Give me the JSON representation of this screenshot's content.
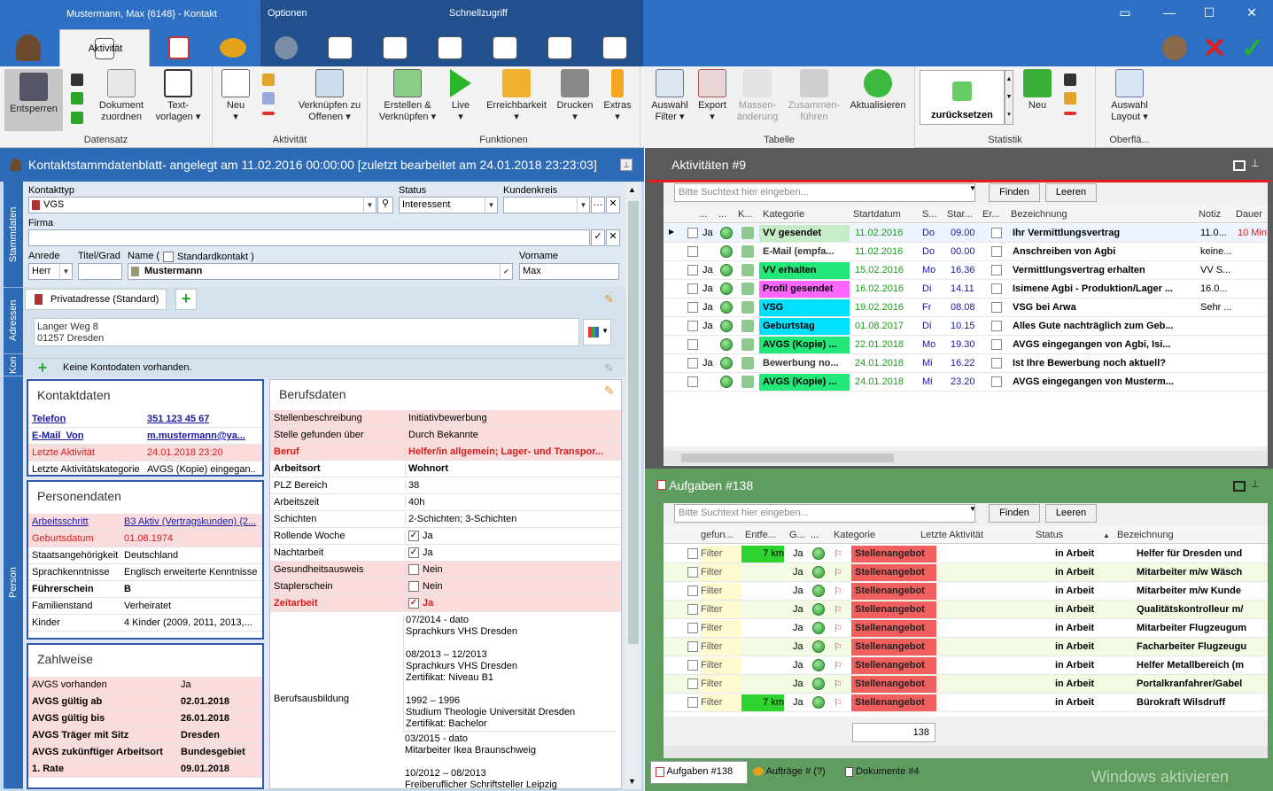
{
  "window": {
    "title": "Mustermann, Max {6148} - Kontakt",
    "ctx_optionen": "Optionen",
    "ctx_schnell": "Schnellzugriff"
  },
  "tabs": {
    "aktivitaet": "Aktivität"
  },
  "ribbon": {
    "datensatz": {
      "name": "Datensatz",
      "entsperren": "Entsperren",
      "dokument": "Dokument zuordnen",
      "textvorlagen": "Text- vorlagen"
    },
    "aktivitaet": {
      "name": "Aktivität",
      "neu": "Neu",
      "verknuepfen": "Verknüpfen zu Offenen"
    },
    "funktionen": {
      "name": "Funktionen",
      "erstellen": "Erstellen & Verknüpfen",
      "live": "Live",
      "erreichbarkeit": "Erreichbarkeit",
      "drucken": "Drucken",
      "extras": "Extras"
    },
    "tabelle": {
      "name": "Tabelle",
      "auswahl": "Auswahl Filter",
      "export": "Export",
      "masse": "Massen- änderung",
      "zusammen": "Zusammen- führen",
      "aktualisieren": "Aktualisieren"
    },
    "statistik": {
      "name": "Statistik",
      "zurueck": "zurücksetzen",
      "neu": "Neu"
    },
    "oberflaeche": {
      "name": "Oberflä...",
      "layout": "Auswahl Layout"
    }
  },
  "left": {
    "header": "Kontaktstammdatenblatt- angelegt am 11.02.2016 00:00:00 [zuletzt bearbeitet am 24.01.2018 23:23:03]",
    "sidetabs": {
      "stamm": "Stammdaten",
      "adressen": "Adressen",
      "kon": "Kon",
      "person": "Person"
    },
    "fields": {
      "kontakttyp_l": "Kontakttyp",
      "kontakttyp": "VGS",
      "status_l": "Status",
      "status": "Interessent",
      "kundenkreis_l": "Kundenkreis",
      "firma_l": "Firma",
      "anrede_l": "Anrede",
      "anrede": "Herr",
      "titel_l": "Titel/Grad",
      "name_l": "Name (",
      "standard_l": "Standardkontakt )",
      "name": "Mustermann",
      "vorname_l": "Vorname",
      "vorname": "Max"
    },
    "address": {
      "tab": "Privatadresse (Standard)",
      "line1": "Langer Weg 8",
      "line2": "01257 Dresden"
    },
    "konto": "Keine Kontodaten vorhanden.",
    "kontaktdaten": {
      "title": "Kontaktdaten",
      "rows": [
        [
          "Telefon",
          "351 123 45 67"
        ],
        [
          "E-Mail_Von",
          "m.mustermann@ya..."
        ],
        [
          "Letzte Aktivität",
          "24.01.2018 23:20"
        ],
        [
          "Letzte Aktivitätskategorie",
          "AVGS (Kopie) eingegan..."
        ]
      ]
    },
    "personendaten": {
      "title": "Personendaten",
      "rows": [
        [
          "Arbeitsschritt",
          "B3 Aktiv (Vertragskunden) {2..."
        ],
        [
          "Geburtsdatum",
          "01.08.1974"
        ],
        [
          "Staatsangehörigkeit",
          "Deutschland"
        ],
        [
          "Sprachkenntnisse",
          "Englisch erweiterte Kenntnisse"
        ],
        [
          "Führerschein",
          "B"
        ],
        [
          "Familienstand",
          "Verheiratet"
        ],
        [
          "Kinder",
          "4 Kinder (2009, 2011, 2013,..."
        ]
      ]
    },
    "zahlweise": {
      "title": "Zahlweise",
      "rows": [
        [
          "AVGS vorhanden",
          "Ja"
        ],
        [
          "AVGS gültig ab",
          "02.01.2018"
        ],
        [
          "AVGS gültig bis",
          "26.01.2018"
        ],
        [
          "AVGS Träger mit Sitz",
          "Dresden"
        ],
        [
          "AVGS zukünftiger Arbeitsort",
          "Bundesgebiet"
        ],
        [
          "1. Rate",
          "09.01.2018"
        ]
      ]
    },
    "berufsdaten": {
      "title": "Berufsdaten",
      "rows": [
        [
          "Stellenbeschreibung",
          "Initiativbewerbung"
        ],
        [
          "Stelle gefunden über",
          "Durch Bekannte"
        ],
        [
          "Beruf",
          "Helfer/in allgemein; Lager- und Transpor..."
        ],
        [
          "Arbeitsort",
          "Wohnort"
        ],
        [
          "PLZ Bereich",
          "38"
        ],
        [
          "Arbeitszeit",
          "40h"
        ],
        [
          "Schichten",
          "2-Schichten; 3-Schichten"
        ],
        [
          "Rollende Woche",
          "Ja"
        ],
        [
          "Nachtarbeit",
          "Ja"
        ],
        [
          "Gesundheitsausweis",
          "Nein"
        ],
        [
          "Staplerschein",
          "Nein"
        ],
        [
          "Zeitarbeit",
          "Ja"
        ]
      ],
      "ausbildung_l": "Berufsausbildung",
      "ausbildung": [
        "07/2014 - dato",
        "Sprachkurs  VHS  Dresden",
        "",
        "08/2013 – 12/2013",
        "Sprachkurs VHS  Dresden",
        "Zertifikat: Niveau B1",
        "",
        "1992 – 1996",
        "Studium Theologie Universität  Dresden",
        "Zertifikat: Bachelor"
      ],
      "taetigkeit": [
        "03/2015 - dato",
        "Mitarbeiter Ikea  Braunschweig",
        "",
        "10/2012 – 08/2013",
        "Freiberuflicher Schriftsteller  Leipzig"
      ]
    }
  },
  "aktivitaeten": {
    "title": "Aktivitäten #9",
    "search_placeholder": "Bitte Suchtext hier eingeben...",
    "finden": "Finden",
    "leeren": "Leeren",
    "headers": [
      "...",
      "...",
      "K...",
      "Kategorie",
      "Startdatum",
      "S...",
      "Star...",
      "Er...",
      "Bezeichnung",
      "Notiz",
      "Dauer"
    ],
    "rows": [
      [
        "Ja",
        "VV gesendet",
        "#c7ecc7",
        "11.02.2016",
        "Do",
        "09.00",
        "Ihr Vermittlungsvertrag",
        "11.0...",
        "10 Min"
      ],
      [
        "",
        "E-Mail (empfa...",
        "#ffffff",
        "11.02.2016",
        "Do",
        "00.00",
        "Anschreiben von Agbi",
        "keine...",
        ""
      ],
      [
        "Ja",
        "VV erhalten",
        "#22e87a",
        "15.02.2016",
        "Mo",
        "16.36",
        "Vermittlungsvertrag erhalten",
        "VV S...",
        ""
      ],
      [
        "Ja",
        "Profil gesendet",
        "#ff66ff",
        "16.02.2016",
        "Di",
        "14.11",
        "Isimene Agbi - Produktion/Lager ...",
        "16.0...",
        ""
      ],
      [
        "Ja",
        "VSG",
        "#00e0ff",
        "19.02.2016",
        "Fr",
        "08.08",
        "VSG bei Arwa",
        "Sehr ...",
        ""
      ],
      [
        "Ja",
        "Geburtstag",
        "#00e0ff",
        "01.08.2017",
        "Di",
        "10.15",
        "Alles Gute nachträglich zum Geb...",
        "",
        ""
      ],
      [
        "",
        "AVGS (Kopie) ...",
        "#22e87a",
        "22.01.2018",
        "Mo",
        "19.30",
        "AVGS eingegangen von Agbi, Isi...",
        "",
        ""
      ],
      [
        "Ja",
        "Bewerbung no...",
        "#ffffff",
        "24.01.2018",
        "Mi",
        "16.22",
        "Ist Ihre Bewerbung noch aktuell?",
        "",
        ""
      ],
      [
        "",
        "AVGS (Kopie) ...",
        "#22e87a",
        "24.01.2018",
        "Mi",
        "23.20",
        "AVGS eingegangen von Musterm...",
        "",
        ""
      ]
    ]
  },
  "aufgaben": {
    "title": "Aufgaben #138",
    "search_placeholder": "Bitte Suchtext hier eingeben...",
    "finden": "Finden",
    "leeren": "Leeren",
    "headers": [
      "gefun...",
      "Entfe...",
      "G...",
      "...",
      "Kategorie",
      "Letzte Aktivität",
      "Status",
      "Bezeichnung"
    ],
    "rows": [
      [
        "Filter",
        "7 km",
        "Ja",
        "Stellenangebot",
        "in Arbeit",
        "Helfer für Dresden und"
      ],
      [
        "Filter",
        "",
        "Ja",
        "Stellenangebot",
        "in Arbeit",
        "Mitarbeiter m/w Wäsch"
      ],
      [
        "Filter",
        "",
        "Ja",
        "Stellenangebot",
        "in Arbeit",
        "Mitarbeiter m/w Kunde"
      ],
      [
        "Filter",
        "",
        "Ja",
        "Stellenangebot",
        "in Arbeit",
        "Qualitätskontrolleur m/"
      ],
      [
        "Filter",
        "",
        "Ja",
        "Stellenangebot",
        "in Arbeit",
        "Mitarbeiter Flugzeugum"
      ],
      [
        "Filter",
        "",
        "Ja",
        "Stellenangebot",
        "in Arbeit",
        "Facharbeiter Flugzeugu"
      ],
      [
        "Filter",
        "",
        "Ja",
        "Stellenangebot",
        "in Arbeit",
        "Helfer Metallbereich (m"
      ],
      [
        "Filter",
        "",
        "Ja",
        "Stellenangebot",
        "in Arbeit",
        "Portalkranfahrer/Gabel"
      ],
      [
        "Filter",
        "7 km",
        "Ja",
        "Stellenangebot",
        "in Arbeit",
        "Bürokraft Wilsdruff"
      ]
    ],
    "count": "138",
    "bottom_tabs": [
      "Aufgaben #138",
      "Aufträge # (?)",
      "Dokumente #4"
    ],
    "watermark": "Windows aktivieren"
  }
}
